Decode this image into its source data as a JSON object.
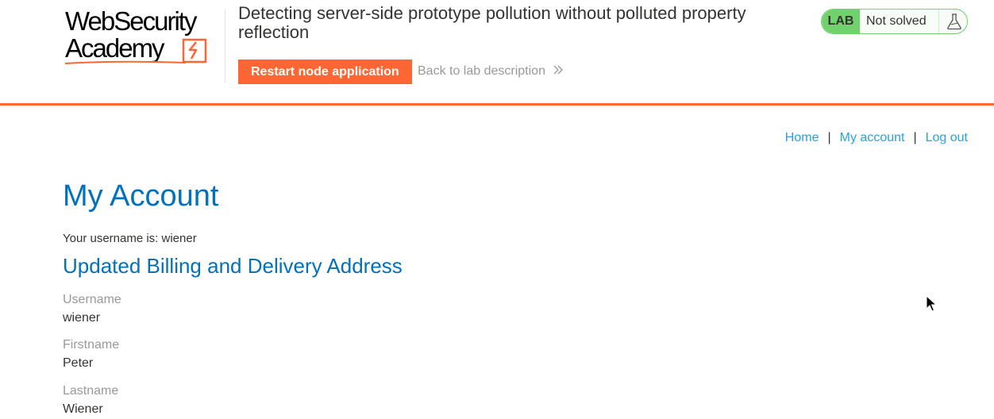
{
  "header": {
    "logo": {
      "line1": "WebSecurity",
      "line2": "Academy"
    },
    "lab_title": "Detecting server-side prototype pollution without polluted property reflection",
    "restart_button_label": "Restart node application",
    "back_link_label": "Back to lab description",
    "lab_status": {
      "badge": "LAB",
      "state": "Not solved",
      "icon": "flask-icon"
    }
  },
  "nav": {
    "home": "Home",
    "sep1": "|",
    "my_account": "My account",
    "sep2": "|",
    "log_out": "Log out"
  },
  "main": {
    "title": "My Account",
    "username_line": "Your username is: wiener",
    "section_title": "Updated Billing and Delivery Address",
    "fields": [
      {
        "label": "Username",
        "value": "wiener"
      },
      {
        "label": "Firstname",
        "value": "Peter"
      },
      {
        "label": "Lastname",
        "value": "Wiener"
      }
    ]
  },
  "colors": {
    "brand_orange": "#ff6633",
    "heading_blue": "#0071bc",
    "link_blue": "#29a3db",
    "lab_green": "#70d16d",
    "muted_grey": "#999999"
  }
}
